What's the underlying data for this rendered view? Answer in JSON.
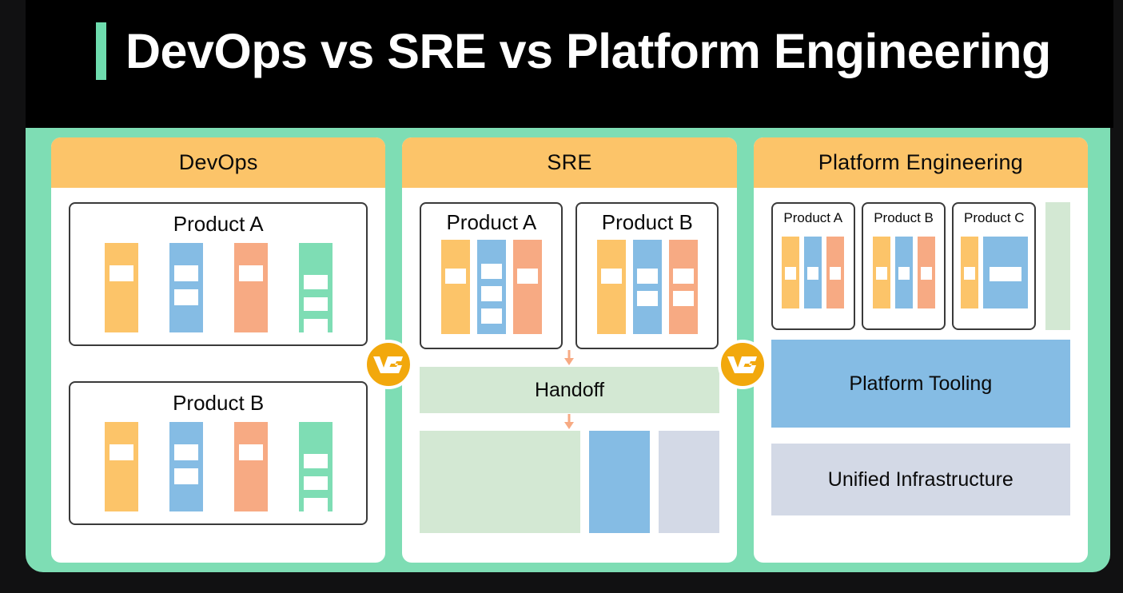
{
  "slide": {
    "title": "DevOps vs SRE vs Platform Engineering",
    "accent_color": "#6EDCAE",
    "header_bg": "#000000",
    "panel_bg": "#7EDDB4",
    "card_header_bg": "#FCC469",
    "vs_badge_color": "#F2A80C",
    "vs_badge_label": "VS"
  },
  "palette": {
    "orange": "#FCC469",
    "blue": "#85BCE4",
    "salmon": "#F7AA83",
    "teal": "#7EDDB4",
    "light_green": "#D3E8D3",
    "lavender": "#D3D9E6",
    "arrow": "#F7AA83"
  },
  "columns": [
    {
      "name": "devops",
      "header": "DevOps",
      "products": [
        {
          "title": "Product A",
          "bars": [
            {
              "color": "#FCC469",
              "slots": 1
            },
            {
              "color": "#85BCE4",
              "slots": 2
            },
            {
              "color": "#F7AA83",
              "slots": 1
            },
            {
              "color": "#7EDDB4",
              "slots": 3
            }
          ]
        },
        {
          "title": "Product B",
          "bars": [
            {
              "color": "#FCC469",
              "slots": 1
            },
            {
              "color": "#85BCE4",
              "slots": 2
            },
            {
              "color": "#F7AA83",
              "slots": 1
            },
            {
              "color": "#7EDDB4",
              "slots": 3
            }
          ]
        }
      ]
    },
    {
      "name": "sre",
      "header": "SRE",
      "products": [
        {
          "title": "Product A",
          "bars": [
            {
              "color": "#FCC469",
              "slots": 1
            },
            {
              "color": "#85BCE4",
              "slots": 3
            },
            {
              "color": "#F7AA83",
              "slots": 1
            }
          ]
        },
        {
          "title": "Product B",
          "bars": [
            {
              "color": "#FCC469",
              "slots": 1
            },
            {
              "color": "#85BCE4",
              "slots": 2
            },
            {
              "color": "#F7AA83",
              "slots": 2
            }
          ]
        }
      ],
      "handoff_label": "Handoff",
      "bottom_blocks": [
        {
          "name": "shared-ops-green",
          "color": "#D3E8D3"
        },
        {
          "name": "shared-ops-blue",
          "color": "#85BCE4"
        },
        {
          "name": "shared-ops-lavender",
          "color": "#D3D9E6"
        }
      ]
    },
    {
      "name": "platform",
      "header": "Platform Engineering",
      "products": [
        {
          "title": "Product A",
          "bars": [
            {
              "color": "#FCC469",
              "slots": 1
            },
            {
              "color": "#85BCE4",
              "slots": 1
            },
            {
              "color": "#F7AA83",
              "slots": 1
            }
          ]
        },
        {
          "title": "Product B",
          "bars": [
            {
              "color": "#FCC469",
              "slots": 1
            },
            {
              "color": "#85BCE4",
              "slots": 1
            },
            {
              "color": "#F7AA83",
              "slots": 1
            }
          ]
        },
        {
          "title": "Product C",
          "bars": [
            {
              "color": "#FCC469",
              "slots": 1
            },
            {
              "color": "#85BCE4",
              "slots": 1,
              "wide": true
            }
          ]
        }
      ],
      "tooling_label": "Platform Tooling",
      "infrastructure_label": "Unified Infrastructure"
    }
  ]
}
